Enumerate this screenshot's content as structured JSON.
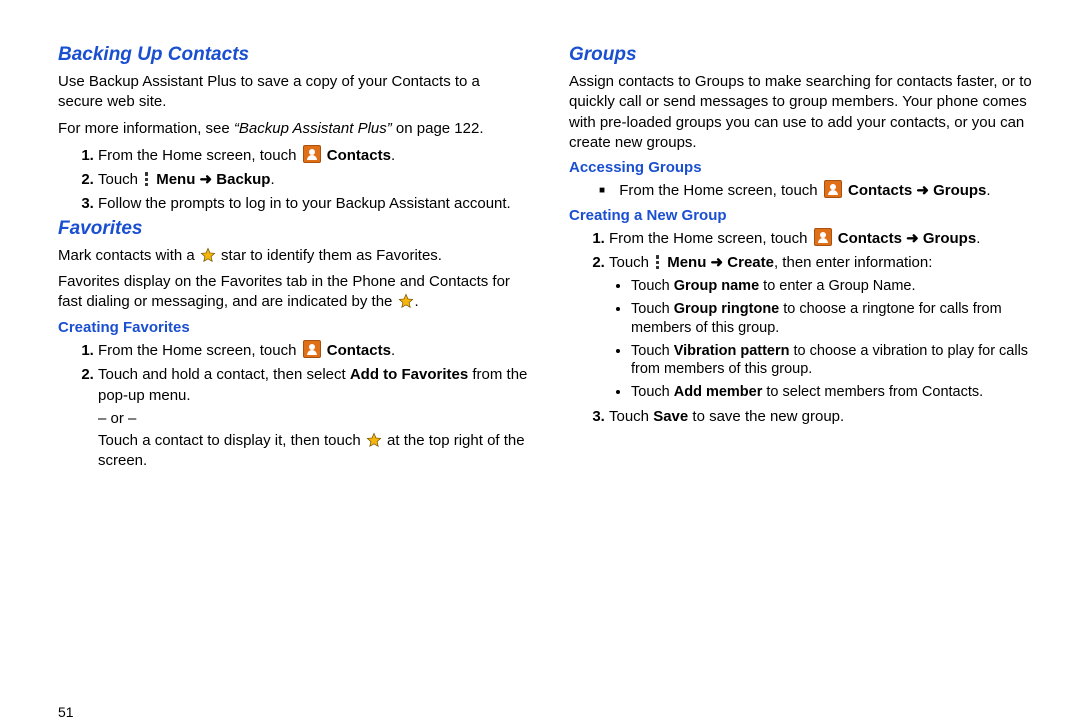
{
  "page_number": "51",
  "left": {
    "backing_up": {
      "heading": "Backing Up Contacts",
      "p1": "Use Backup Assistant Plus to save a copy of your Contacts to a secure web site.",
      "p2_a": "For more information, see ",
      "p2_ref": "“Backup Assistant Plus”",
      "p2_b": " on page 122.",
      "step1_a": "From the Home screen, touch ",
      "step1_b": "Contacts",
      "step1_c": ".",
      "step2_a": "Touch ",
      "step2_b": "Menu ➜ Backup",
      "step2_c": ".",
      "step3": "Follow the prompts to log in to your Backup Assistant account."
    },
    "favorites": {
      "heading": "Favorites",
      "p1_a": "Mark contacts with a ",
      "p1_b": " star to identify them as Favorites.",
      "p2_a": "Favorites display on the Favorites tab in the Phone and Contacts for fast dialing or messaging, and are indicated by the ",
      "p2_b": ".",
      "sub_heading": "Creating Favorites",
      "step1_a": "From the Home screen, touch ",
      "step1_b": "Contacts",
      "step1_c": ".",
      "step2_a": "Touch and hold a contact, then select ",
      "step2_b": "Add to Favorites",
      "step2_c": " from the pop-up menu.",
      "or": "– or –",
      "alt_a": "Touch a contact to display it, then touch ",
      "alt_b": " at the top right of the screen."
    }
  },
  "right": {
    "groups": {
      "heading": "Groups",
      "p1": "Assign contacts to Groups to make searching for contacts faster, or to quickly call or send messages to group members. Your phone comes with pre-loaded groups you can use to add your contacts, or you can create new groups."
    },
    "accessing": {
      "heading": "Accessing Groups",
      "line_a": "From the Home screen, touch ",
      "line_b": "Contacts ➜ Groups",
      "line_c": "."
    },
    "creating": {
      "heading": "Creating a New Group",
      "step1_a": "From the Home screen, touch ",
      "step1_b": "Contacts ➜ Groups",
      "step1_c": ".",
      "step2_a": "Touch ",
      "step2_b": "Menu ➜ Create",
      "step2_c": ", then enter information:",
      "b1_a": "Touch ",
      "b1_b": "Group name",
      "b1_c": " to enter a Group Name.",
      "b2_a": "Touch ",
      "b2_b": "Group ringtone",
      "b2_c": " to choose a ringtone for calls from members of this group.",
      "b3_a": "Touch ",
      "b3_b": "Vibration pattern",
      "b3_c": " to choose a vibration to play for calls from members of this group.",
      "b4_a": "Touch ",
      "b4_b": "Add member",
      "b4_c": " to select members from Contacts.",
      "step3_a": "Touch ",
      "step3_b": "Save",
      "step3_c": " to save the new group."
    }
  }
}
